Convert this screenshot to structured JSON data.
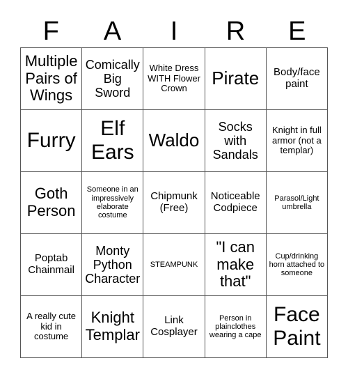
{
  "card": {
    "title_letters": [
      "F",
      "A",
      "I",
      "R",
      "E"
    ],
    "free_space_text": "Chipmunk (Free)",
    "colors": {
      "background": "#ffffff",
      "border": "#555555",
      "text": "#000000"
    },
    "grid": {
      "columns": 5,
      "rows": 5,
      "cells": [
        {
          "text": "Multiple Pairs of Wings",
          "size": "lg"
        },
        {
          "text": "Comically Big Sword",
          "size": "md"
        },
        {
          "text": "White Dress WITH Flower Crown",
          "size": "xs"
        },
        {
          "text": "Pirate",
          "size": "xl"
        },
        {
          "text": "Body/face paint",
          "size": "sm"
        },
        {
          "text": "Furry",
          "size": "xxl"
        },
        {
          "text": "Elf Ears",
          "size": "xxl"
        },
        {
          "text": "Waldo",
          "size": "xl"
        },
        {
          "text": "Socks with Sandals",
          "size": "md"
        },
        {
          "text": "Knight in full armor (not a templar)",
          "size": "xs"
        },
        {
          "text": "Goth Person",
          "size": "lg"
        },
        {
          "text": "Someone in an impressively elaborate costume",
          "size": "xxs"
        },
        {
          "text": "Chipmunk (Free)",
          "size": "sm"
        },
        {
          "text": "Noticeable Codpiece",
          "size": "sm"
        },
        {
          "text": "Parasol/Light umbrella",
          "size": "xxs"
        },
        {
          "text": "Poptab Chainmail",
          "size": "sm"
        },
        {
          "text": "Monty Python Character",
          "size": "md"
        },
        {
          "text": "STEAMPUNK",
          "size": "xxs"
        },
        {
          "text": "\"I can make that\"",
          "size": "lg"
        },
        {
          "text": "Cup/drinking horn attached to someone",
          "size": "xxs"
        },
        {
          "text": "A really cute kid in costume",
          "size": "xs"
        },
        {
          "text": "Knight Templar",
          "size": "lg"
        },
        {
          "text": "Link Cosplayer",
          "size": "sm"
        },
        {
          "text": "Person in plainclothes wearing a cape",
          "size": "xxs"
        },
        {
          "text": "Face Paint",
          "size": "xxl"
        }
      ]
    }
  }
}
